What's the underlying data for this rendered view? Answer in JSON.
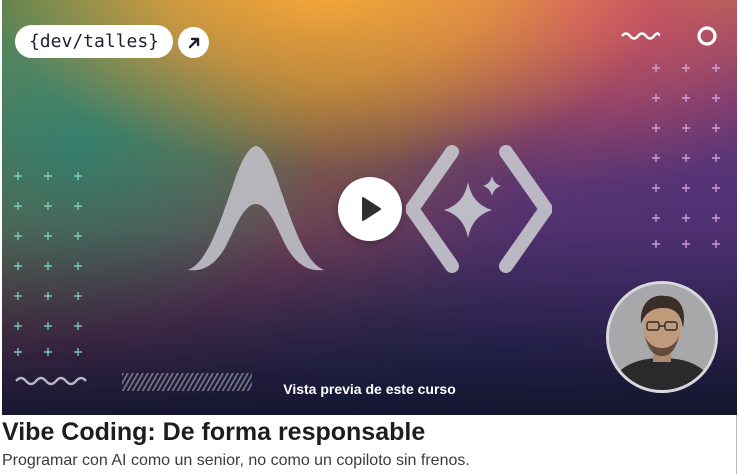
{
  "preview": {
    "logo_text": "{dev/talles}",
    "label": "Vista previa de este curso"
  },
  "icons": {
    "logo_link": "arrow-up-right-icon",
    "play": "play-icon",
    "brand_mark": "a-mark-icon",
    "code_sparkle": "code-brackets-sparkle-icon",
    "wave": "wave-icon",
    "ring": "circle-icon"
  },
  "course": {
    "title": "Vibe Coding: De forma responsable",
    "subtitle": "Programar con AI como un senior, no como un copiloto sin frenos."
  },
  "colors": {
    "title": "#1c1d1f",
    "subtitle": "#3a3b3e",
    "play_button": "#ffffff",
    "play_triangle": "#2d2f31"
  }
}
